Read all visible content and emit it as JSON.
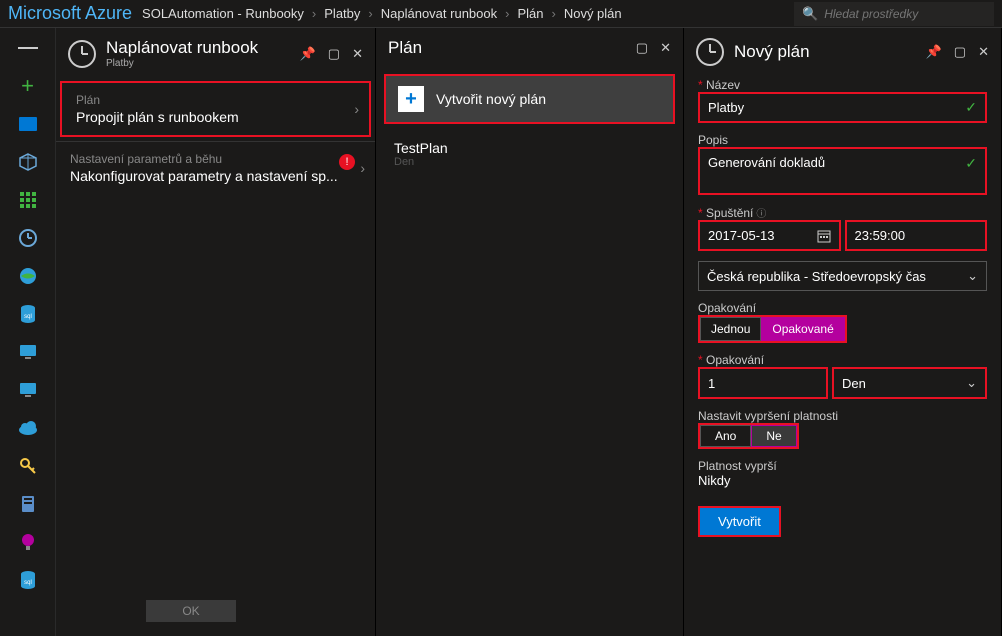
{
  "brand": "Microsoft Azure",
  "breadcrumbs": [
    "SOLAutomation - Runbooky",
    "Platby",
    "Naplánovat runbook",
    "Plán",
    "Nový plán"
  ],
  "search_placeholder": "Hledat prostředky",
  "blade1": {
    "title": "Naplánovat runbook",
    "subtitle": "Platby",
    "item_plan": {
      "label": "Plán",
      "text": "Propojit plán s runbookem"
    },
    "item_params": {
      "label": "Nastavení parametrů a běhu",
      "text": "Nakonfigurovat parametry a nastavení sp..."
    },
    "ok": "OK"
  },
  "blade2": {
    "title": "Plán",
    "create_new": "Vytvořit nový plán",
    "schedules": [
      {
        "name": "TestPlan",
        "sub": "Den"
      }
    ]
  },
  "blade3": {
    "title": "Nový plán",
    "labels": {
      "name": "Název",
      "desc": "Popis",
      "start": "Spuštění",
      "recurrence": "Opakování",
      "recurrence2": "Opakování",
      "expiry_set": "Nastavit vypršení platnosti",
      "expires": "Platnost vyprší"
    },
    "values": {
      "name": "Platby",
      "desc": "Generování dokladů",
      "date": "2017-05-13",
      "time": "23:59:00",
      "timezone": "Česká republika - Středoevropský čas",
      "recur_once": "Jednou",
      "recur_repeat": "Opakované",
      "interval": "1",
      "unit": "Den",
      "yes": "Ano",
      "no": "Ne",
      "expires_val": "Nikdy",
      "create": "Vytvořit"
    }
  }
}
